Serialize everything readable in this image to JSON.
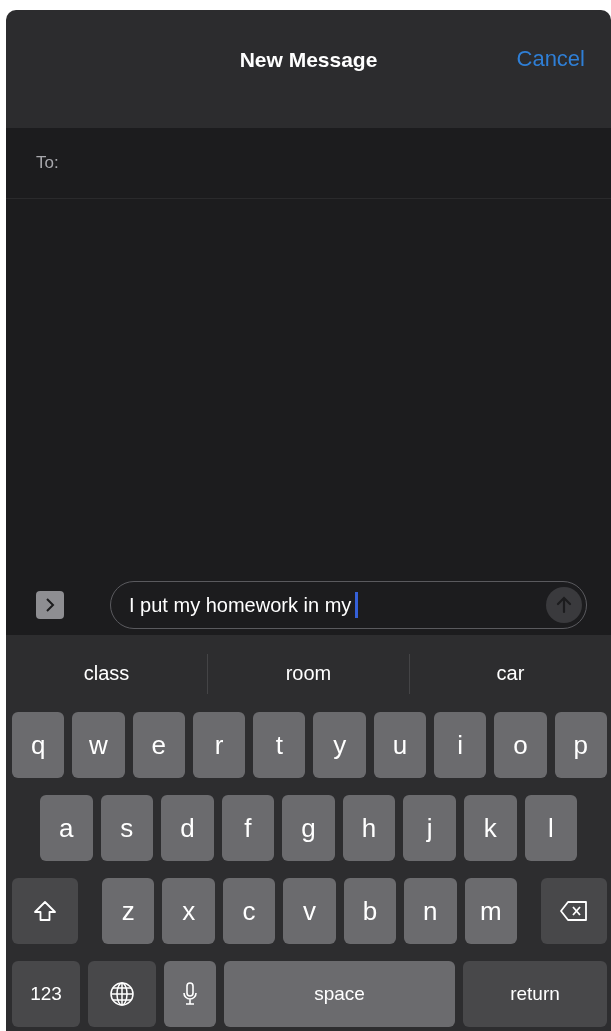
{
  "header": {
    "title": "New Message",
    "cancel": "Cancel"
  },
  "to_field": {
    "label": "To:"
  },
  "compose": {
    "text": "I put my homework in my",
    "send_enabled": false
  },
  "suggestions": [
    {
      "text": "class"
    },
    {
      "text": "room"
    },
    {
      "text": "car"
    }
  ],
  "keyboard": [
    [
      {
        "kind": "letter",
        "label": "q"
      },
      {
        "kind": "letter",
        "label": "w"
      },
      {
        "kind": "letter",
        "label": "e"
      },
      {
        "kind": "letter",
        "label": "r"
      },
      {
        "kind": "letter",
        "label": "t"
      },
      {
        "kind": "letter",
        "label": "y"
      },
      {
        "kind": "letter",
        "label": "u"
      },
      {
        "kind": "letter",
        "label": "i"
      },
      {
        "kind": "letter",
        "label": "o"
      },
      {
        "kind": "letter",
        "label": "p"
      }
    ],
    [
      {
        "kind": "letter",
        "label": "a"
      },
      {
        "kind": "letter",
        "label": "s"
      },
      {
        "kind": "letter",
        "label": "d"
      },
      {
        "kind": "letter",
        "label": "f"
      },
      {
        "kind": "letter",
        "label": "g"
      },
      {
        "kind": "letter",
        "label": "h"
      },
      {
        "kind": "letter",
        "label": "j"
      },
      {
        "kind": "letter",
        "label": "k"
      },
      {
        "kind": "letter",
        "label": "l"
      }
    ],
    [
      {
        "kind": "shift"
      },
      {
        "kind": "letter",
        "label": "z"
      },
      {
        "kind": "letter",
        "label": "x"
      },
      {
        "kind": "letter",
        "label": "c"
      },
      {
        "kind": "letter",
        "label": "v"
      },
      {
        "kind": "letter",
        "label": "b"
      },
      {
        "kind": "letter",
        "label": "n"
      },
      {
        "kind": "letter",
        "label": "m"
      },
      {
        "kind": "delete"
      }
    ],
    [
      {
        "kind": "numbers",
        "label": "123"
      },
      {
        "kind": "globe"
      },
      {
        "kind": "mic"
      },
      {
        "kind": "space",
        "label": "space"
      },
      {
        "kind": "return",
        "label": "return"
      }
    ]
  ]
}
